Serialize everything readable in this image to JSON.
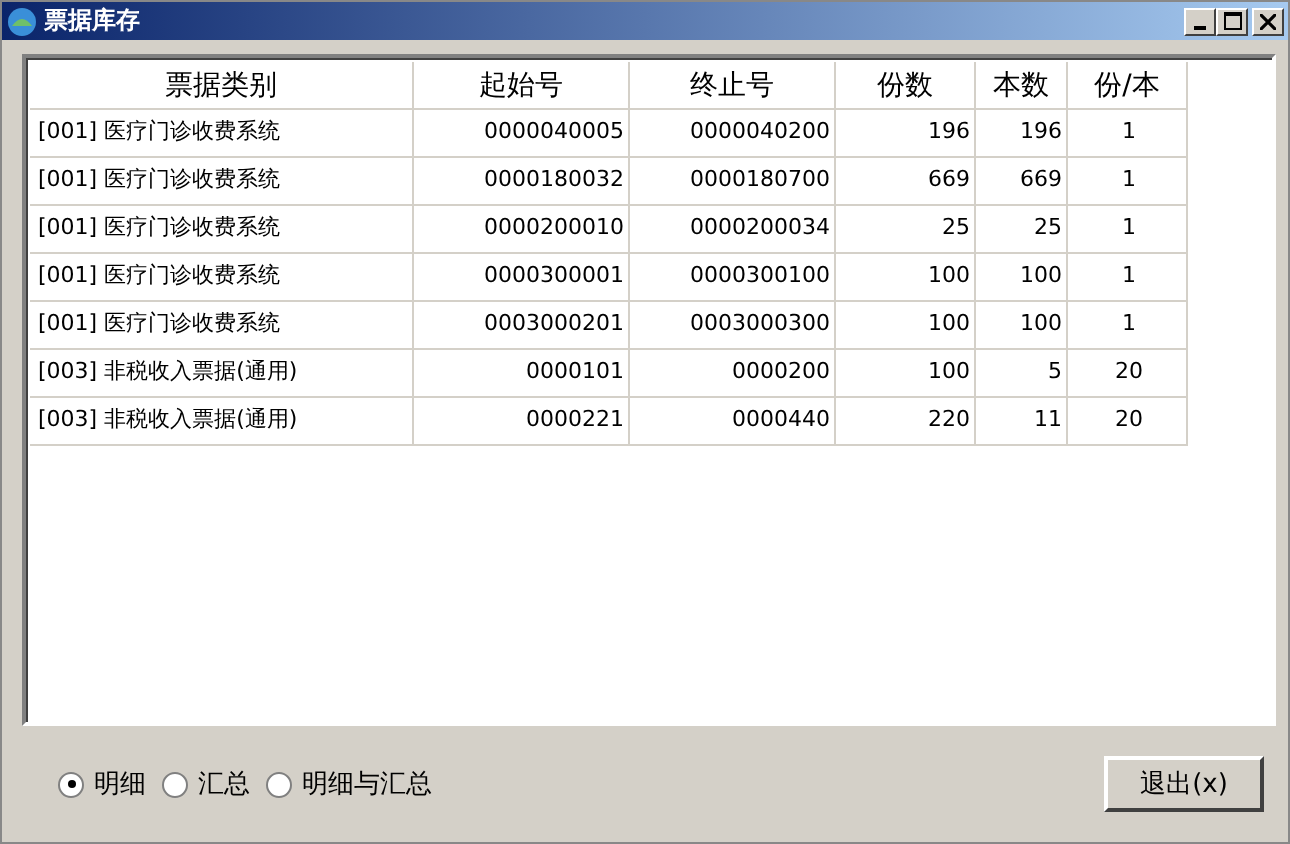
{
  "window": {
    "title": "票据库存"
  },
  "table": {
    "columns": [
      "票据类别",
      "起始号",
      "终止号",
      "份数",
      "本数",
      "份/本"
    ],
    "rows": [
      [
        "[001] 医疗门诊收费系统",
        "0000040005",
        "0000040200",
        "196",
        "196",
        "1"
      ],
      [
        "[001] 医疗门诊收费系统",
        "0000180032",
        "0000180700",
        "669",
        "669",
        "1"
      ],
      [
        "[001] 医疗门诊收费系统",
        "0000200010",
        "0000200034",
        "25",
        "25",
        "1"
      ],
      [
        "[001] 医疗门诊收费系统",
        "0000300001",
        "0000300100",
        "100",
        "100",
        "1"
      ],
      [
        "[001] 医疗门诊收费系统",
        "0003000201",
        "0003000300",
        "100",
        "100",
        "1"
      ],
      [
        "[003] 非税收入票据(通用)",
        "0000101",
        "0000200",
        "100",
        "5",
        "20"
      ],
      [
        "[003] 非税收入票据(通用)",
        "0000221",
        "0000440",
        "220",
        "11",
        "20"
      ]
    ]
  },
  "view_options": [
    {
      "label": "明细",
      "selected": true
    },
    {
      "label": "汇总",
      "selected": false
    },
    {
      "label": "明细与汇总",
      "selected": false
    }
  ],
  "exit_button": "退出(x)"
}
